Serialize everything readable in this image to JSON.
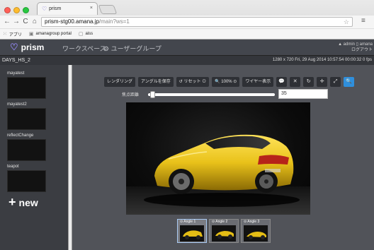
{
  "browser": {
    "tab_title": "prism",
    "tab_close": "×",
    "url_host": "prism-stg00.amana.jp",
    "url_path": "/main?ws=1",
    "nav_back": "←",
    "nav_forward": "→",
    "nav_reload": "C",
    "nav_home": "⌂",
    "star": "☆",
    "menu": "≡",
    "bookmarks": [
      {
        "icon": "apps-icon",
        "label": "アプリ"
      },
      {
        "icon": "page-icon",
        "label": "amanagroup portal"
      },
      {
        "icon": "page-icon",
        "label": "aiss"
      }
    ],
    "colors": {
      "close": "#ff5f57",
      "minimize": "#febc2e",
      "maximize": "#28c840"
    }
  },
  "app": {
    "logo_text": "prism",
    "logo_color": "#8e84ea",
    "nav": [
      "ワークスペース",
      "⚙ ユーザーグループ"
    ],
    "user_name": "▲ admin ▯ amana",
    "logout_label": "ログアウト"
  },
  "status": {
    "scene_name": "DAYS_HS_2",
    "info": "1280 x 720  Fri, 29 Aug 2014 10:57:54  00:00:32  0 fps"
  },
  "sidebar": {
    "scenes": [
      {
        "label": "mayatest"
      },
      {
        "label": "mayatest2"
      },
      {
        "label": "reflectChange"
      },
      {
        "label": "teapot"
      }
    ],
    "new_label": "new",
    "new_icon": "+"
  },
  "controls": {
    "buttons": [
      {
        "label": "レンダリング",
        "icon": null,
        "active": false
      },
      {
        "label": "アングルを保存",
        "icon": null,
        "active": false
      },
      {
        "label": "↺ リセット ⊙",
        "icon": null,
        "active": false
      },
      {
        "label": "🔍 100% ⊙",
        "icon": null,
        "active": false
      },
      {
        "label": "ワイヤー表示",
        "icon": null,
        "active": false
      },
      {
        "label": "💬",
        "icon": "comment-icon",
        "active": false
      },
      {
        "label": "✕",
        "icon": "shuffle-icon",
        "active": false
      },
      {
        "label": "↻",
        "icon": "rotate-icon",
        "active": false
      },
      {
        "label": "✛",
        "icon": "move-icon",
        "active": false
      },
      {
        "label": "⤢",
        "icon": "expand-icon",
        "active": false
      },
      {
        "label": "🔍",
        "icon": "search-icon",
        "active": true
      }
    ],
    "focal_label": "焦点距離",
    "focal_value": "35",
    "slider_value": 0.02
  },
  "angles": [
    {
      "label": "⊙ Angle 1",
      "selected": true
    },
    {
      "label": "⊙ Angle 2",
      "selected": false
    },
    {
      "label": "⊙ Angle 3",
      "selected": false
    }
  ]
}
